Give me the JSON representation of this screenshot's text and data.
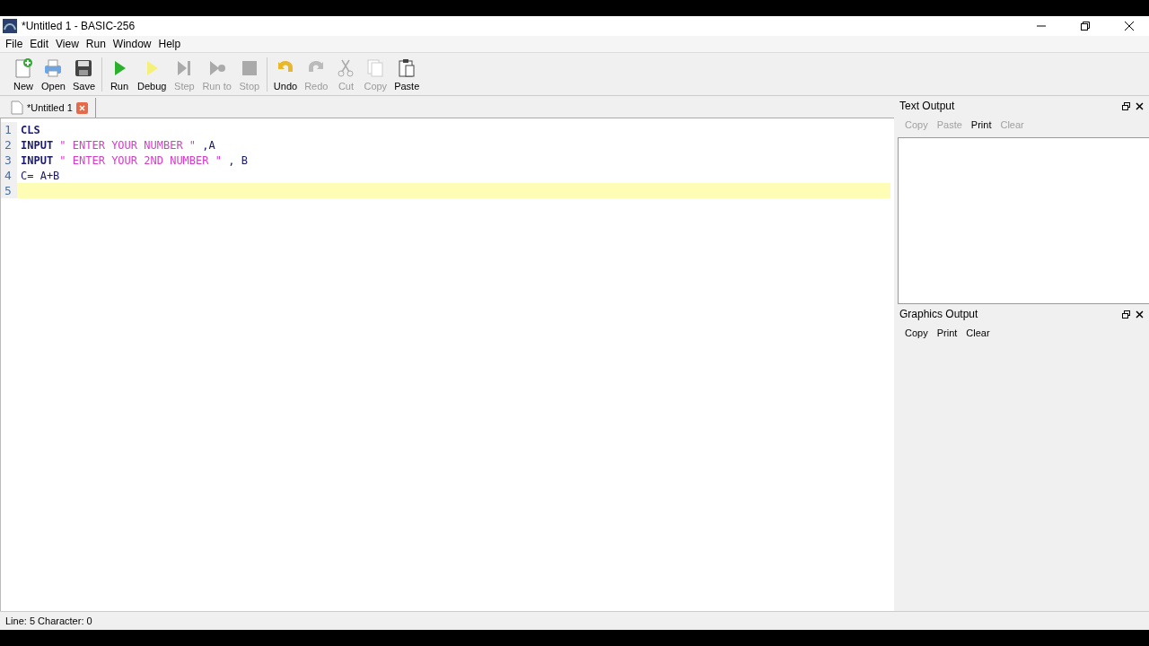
{
  "window": {
    "title": "*Untitled 1 - BASIC-256"
  },
  "menu": [
    "File",
    "Edit",
    "View",
    "Run",
    "Window",
    "Help"
  ],
  "toolbar": [
    {
      "label": "New",
      "disabled": false
    },
    {
      "label": "Open",
      "disabled": false
    },
    {
      "label": "Save",
      "disabled": false
    },
    {
      "label": "Run",
      "disabled": false
    },
    {
      "label": "Debug",
      "disabled": false
    },
    {
      "label": "Step",
      "disabled": true
    },
    {
      "label": "Run to",
      "disabled": true
    },
    {
      "label": "Stop",
      "disabled": true
    },
    {
      "label": "Undo",
      "disabled": false
    },
    {
      "label": "Redo",
      "disabled": true
    },
    {
      "label": "Cut",
      "disabled": true
    },
    {
      "label": "Copy",
      "disabled": true
    },
    {
      "label": "Paste",
      "disabled": false
    }
  ],
  "tabs": [
    {
      "label": "*Untitled 1",
      "selected": true
    }
  ],
  "editor": {
    "lines": [
      {
        "number": "1",
        "current": false,
        "tokens": [
          {
            "kind": "keyword",
            "text": "CLS"
          }
        ]
      },
      {
        "number": "2",
        "current": false,
        "tokens": [
          {
            "kind": "keyword",
            "text": "INPUT"
          },
          {
            "kind": "string",
            "text": " \" ENTER YOUR NUMBER \""
          },
          {
            "kind": "plain",
            "text": " ,A"
          }
        ]
      },
      {
        "number": "3",
        "current": false,
        "tokens": [
          {
            "kind": "keyword",
            "text": "INPUT"
          },
          {
            "kind": "string",
            "text": " \" ENTER YOUR 2ND NUMBER \""
          },
          {
            "kind": "plain",
            "text": " , B"
          }
        ]
      },
      {
        "number": "4",
        "current": false,
        "tokens": [
          {
            "kind": "plain",
            "text": "C= A+B"
          }
        ]
      },
      {
        "number": "5",
        "current": true
      }
    ]
  },
  "text_output": {
    "title": "Text Output",
    "actions": [
      {
        "label": "Copy",
        "disabled": true
      },
      {
        "label": "Paste",
        "disabled": true
      },
      {
        "label": "Print",
        "disabled": false
      },
      {
        "label": "Clear",
        "disabled": true
      }
    ]
  },
  "graphics_output": {
    "title": "Graphics Output",
    "actions": [
      {
        "label": "Copy",
        "disabled": false
      },
      {
        "label": "Print",
        "disabled": false
      },
      {
        "label": "Clear",
        "disabled": false
      }
    ]
  },
  "status_bar": "Line: 5 Character: 0"
}
